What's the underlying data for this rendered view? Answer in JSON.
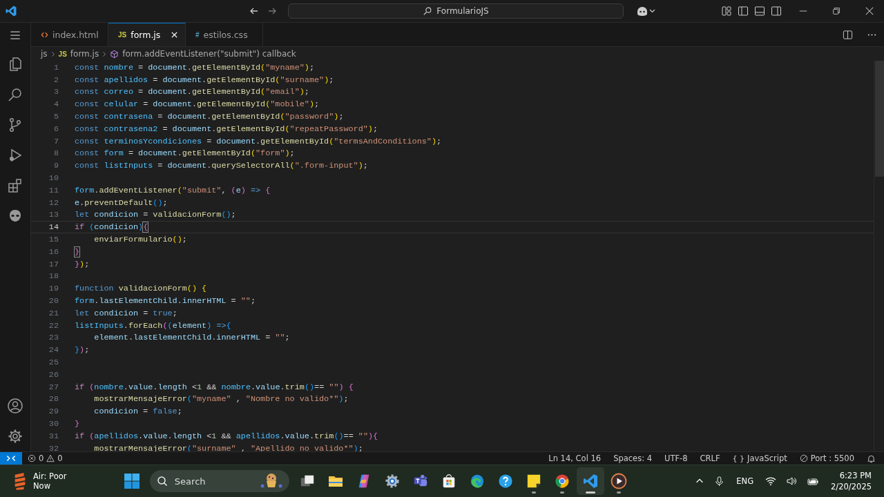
{
  "window": {
    "title": "FormularioJS"
  },
  "tabs": [
    {
      "label": "index.html",
      "kind": "html",
      "selected": false
    },
    {
      "label": "form.js",
      "kind": "js",
      "icon_text": "JS",
      "selected": true
    },
    {
      "label": "estilos.css",
      "kind": "css",
      "icon_text": "#",
      "selected": false
    }
  ],
  "breadcrumb": [
    {
      "kind": "folder",
      "label": "js"
    },
    {
      "kind": "file",
      "label": "form.js",
      "icon_text": "JS"
    },
    {
      "kind": "symbol",
      "label": "form.addEventListener(\"submit\") callback"
    }
  ],
  "editor": {
    "lines": [
      {
        "number": "1",
        "current": false,
        "tokens": [
          {
            "kind": "keyword",
            "text": "const "
          },
          {
            "kind": "constant",
            "text": "nombre"
          },
          {
            "kind": "plain",
            "text": " = "
          },
          {
            "kind": "variable",
            "text": "document"
          },
          {
            "kind": "plain",
            "text": "."
          },
          {
            "kind": "function",
            "text": "getElementById"
          },
          {
            "kind": "bracket1",
            "text": "("
          },
          {
            "kind": "string",
            "text": "\"myname\""
          },
          {
            "kind": "bracket1",
            "text": ")"
          },
          {
            "kind": "plain",
            "text": ";"
          }
        ]
      },
      {
        "number": "2",
        "current": false,
        "tokens": [
          {
            "kind": "keyword",
            "text": "const "
          },
          {
            "kind": "constant",
            "text": "apellidos"
          },
          {
            "kind": "plain",
            "text": " = "
          },
          {
            "kind": "variable",
            "text": "document"
          },
          {
            "kind": "plain",
            "text": "."
          },
          {
            "kind": "function",
            "text": "getElementById"
          },
          {
            "kind": "bracket1",
            "text": "("
          },
          {
            "kind": "string",
            "text": "\"surname\""
          },
          {
            "kind": "bracket1",
            "text": ")"
          },
          {
            "kind": "plain",
            "text": ";"
          }
        ]
      },
      {
        "number": "3",
        "current": false,
        "tokens": [
          {
            "kind": "keyword",
            "text": "const "
          },
          {
            "kind": "constant",
            "text": "correo"
          },
          {
            "kind": "plain",
            "text": " = "
          },
          {
            "kind": "variable",
            "text": "document"
          },
          {
            "kind": "plain",
            "text": "."
          },
          {
            "kind": "function",
            "text": "getElementById"
          },
          {
            "kind": "bracket1",
            "text": "("
          },
          {
            "kind": "string",
            "text": "\"email\""
          },
          {
            "kind": "bracket1",
            "text": ")"
          },
          {
            "kind": "plain",
            "text": ";"
          }
        ]
      },
      {
        "number": "4",
        "current": false,
        "tokens": [
          {
            "kind": "keyword",
            "text": "const "
          },
          {
            "kind": "constant",
            "text": "celular"
          },
          {
            "kind": "plain",
            "text": " = "
          },
          {
            "kind": "variable",
            "text": "document"
          },
          {
            "kind": "plain",
            "text": "."
          },
          {
            "kind": "function",
            "text": "getElementById"
          },
          {
            "kind": "bracket1",
            "text": "("
          },
          {
            "kind": "string",
            "text": "\"mobile\""
          },
          {
            "kind": "bracket1",
            "text": ")"
          },
          {
            "kind": "plain",
            "text": ";"
          }
        ]
      },
      {
        "number": "5",
        "current": false,
        "tokens": [
          {
            "kind": "keyword",
            "text": "const "
          },
          {
            "kind": "constant",
            "text": "contrasena"
          },
          {
            "kind": "plain",
            "text": " = "
          },
          {
            "kind": "variable",
            "text": "document"
          },
          {
            "kind": "plain",
            "text": "."
          },
          {
            "kind": "function",
            "text": "getElementById"
          },
          {
            "kind": "bracket1",
            "text": "("
          },
          {
            "kind": "string",
            "text": "\"password\""
          },
          {
            "kind": "bracket1",
            "text": ")"
          },
          {
            "kind": "plain",
            "text": ";"
          }
        ]
      },
      {
        "number": "6",
        "current": false,
        "tokens": [
          {
            "kind": "keyword",
            "text": "const "
          },
          {
            "kind": "constant",
            "text": "contrasena2"
          },
          {
            "kind": "plain",
            "text": " = "
          },
          {
            "kind": "variable",
            "text": "document"
          },
          {
            "kind": "plain",
            "text": "."
          },
          {
            "kind": "function",
            "text": "getElementById"
          },
          {
            "kind": "bracket1",
            "text": "("
          },
          {
            "kind": "string",
            "text": "\"repeatPassword\""
          },
          {
            "kind": "bracket1",
            "text": ")"
          },
          {
            "kind": "plain",
            "text": ";"
          }
        ]
      },
      {
        "number": "7",
        "current": false,
        "tokens": [
          {
            "kind": "keyword",
            "text": "const "
          },
          {
            "kind": "constant",
            "text": "terminosYcondiciones"
          },
          {
            "kind": "plain",
            "text": " = "
          },
          {
            "kind": "variable",
            "text": "document"
          },
          {
            "kind": "plain",
            "text": "."
          },
          {
            "kind": "function",
            "text": "getElementById"
          },
          {
            "kind": "bracket1",
            "text": "("
          },
          {
            "kind": "string",
            "text": "\"termsAndConditions\""
          },
          {
            "kind": "bracket1",
            "text": ")"
          },
          {
            "kind": "plain",
            "text": ";"
          }
        ]
      },
      {
        "number": "8",
        "current": false,
        "tokens": [
          {
            "kind": "keyword",
            "text": "const "
          },
          {
            "kind": "constant",
            "text": "form"
          },
          {
            "kind": "plain",
            "text": " = "
          },
          {
            "kind": "variable",
            "text": "document"
          },
          {
            "kind": "plain",
            "text": "."
          },
          {
            "kind": "function",
            "text": "getElementById"
          },
          {
            "kind": "bracket1",
            "text": "("
          },
          {
            "kind": "string",
            "text": "\"form\""
          },
          {
            "kind": "bracket1",
            "text": ")"
          },
          {
            "kind": "plain",
            "text": ";"
          }
        ]
      },
      {
        "number": "9",
        "current": false,
        "tokens": [
          {
            "kind": "keyword",
            "text": "const "
          },
          {
            "kind": "constant",
            "text": "listInputs"
          },
          {
            "kind": "plain",
            "text": " = "
          },
          {
            "kind": "variable",
            "text": "document"
          },
          {
            "kind": "plain",
            "text": "."
          },
          {
            "kind": "function",
            "text": "querySelectorAll"
          },
          {
            "kind": "bracket1",
            "text": "("
          },
          {
            "kind": "string",
            "text": "\".form-input\""
          },
          {
            "kind": "bracket1",
            "text": ")"
          },
          {
            "kind": "plain",
            "text": ";"
          }
        ]
      },
      {
        "number": "10",
        "current": false
      },
      {
        "number": "11",
        "current": false,
        "tokens": [
          {
            "kind": "constant",
            "text": "form"
          },
          {
            "kind": "plain",
            "text": "."
          },
          {
            "kind": "function",
            "text": "addEventListener"
          },
          {
            "kind": "bracket1",
            "text": "("
          },
          {
            "kind": "string",
            "text": "\"submit\""
          },
          {
            "kind": "plain",
            "text": ", "
          },
          {
            "kind": "bracket2",
            "text": "("
          },
          {
            "kind": "variable",
            "text": "e"
          },
          {
            "kind": "bracket2",
            "text": ")"
          },
          {
            "kind": "keyword",
            "text": " => "
          },
          {
            "kind": "bracket2",
            "text": "{"
          }
        ]
      },
      {
        "number": "12",
        "current": false,
        "tokens": [
          {
            "kind": "variable",
            "text": "e"
          },
          {
            "kind": "plain",
            "text": "."
          },
          {
            "kind": "function",
            "text": "preventDefault"
          },
          {
            "kind": "bracket3",
            "text": "()"
          },
          {
            "kind": "plain",
            "text": ";"
          }
        ]
      },
      {
        "number": "13",
        "current": false,
        "tokens": [
          {
            "kind": "keyword",
            "text": "let "
          },
          {
            "kind": "variable",
            "text": "condicion"
          },
          {
            "kind": "plain",
            "text": " = "
          },
          {
            "kind": "function",
            "text": "validacionForm"
          },
          {
            "kind": "bracket3",
            "text": "()"
          },
          {
            "kind": "plain",
            "text": ";"
          }
        ]
      },
      {
        "number": "14",
        "current": true,
        "tokens": [
          {
            "kind": "control",
            "text": "if "
          },
          {
            "kind": "bracket3",
            "text": "("
          },
          {
            "kind": "variable",
            "text": "condicion"
          },
          {
            "kind": "bracket3",
            "text": ")"
          },
          {
            "kind": "match",
            "text": "{"
          }
        ]
      },
      {
        "number": "15",
        "current": false,
        "tokens": [
          {
            "kind": "function",
            "text": "    enviarFormulario"
          },
          {
            "kind": "bracket1",
            "text": "()"
          },
          {
            "kind": "plain",
            "text": ";"
          }
        ]
      },
      {
        "number": "16",
        "current": false,
        "tokens": [
          {
            "kind": "match",
            "text": "}"
          }
        ]
      },
      {
        "number": "17",
        "current": false,
        "tokens": [
          {
            "kind": "bracket2",
            "text": "}"
          },
          {
            "kind": "bracket1",
            "text": ")"
          },
          {
            "kind": "plain",
            "text": ";"
          }
        ]
      },
      {
        "number": "18",
        "current": false
      },
      {
        "number": "19",
        "current": false,
        "tokens": [
          {
            "kind": "keyword",
            "text": "function "
          },
          {
            "kind": "function",
            "text": "validacionForm"
          },
          {
            "kind": "bracket1",
            "text": "()"
          },
          {
            "kind": "bracket1",
            "text": " {"
          }
        ]
      },
      {
        "number": "20",
        "current": false,
        "tokens": [
          {
            "kind": "constant",
            "text": "form"
          },
          {
            "kind": "plain",
            "text": "."
          },
          {
            "kind": "variable",
            "text": "lastElementChild"
          },
          {
            "kind": "plain",
            "text": "."
          },
          {
            "kind": "variable",
            "text": "innerHTML"
          },
          {
            "kind": "plain",
            "text": " = "
          },
          {
            "kind": "string",
            "text": "\"\""
          },
          {
            "kind": "plain",
            "text": ";"
          }
        ]
      },
      {
        "number": "21",
        "current": false,
        "tokens": [
          {
            "kind": "keyword",
            "text": "let "
          },
          {
            "kind": "variable",
            "text": "condicion"
          },
          {
            "kind": "plain",
            "text": " = "
          },
          {
            "kind": "keyword",
            "text": "true"
          },
          {
            "kind": "plain",
            "text": ";"
          }
        ]
      },
      {
        "number": "22",
        "current": false,
        "tokens": [
          {
            "kind": "constant",
            "text": "listInputs"
          },
          {
            "kind": "plain",
            "text": "."
          },
          {
            "kind": "function",
            "text": "forEach"
          },
          {
            "kind": "bracket2",
            "text": "("
          },
          {
            "kind": "bracket3",
            "text": "("
          },
          {
            "kind": "variable",
            "text": "element"
          },
          {
            "kind": "bracket3",
            "text": ")"
          },
          {
            "kind": "keyword",
            "text": " =>"
          },
          {
            "kind": "bracket3",
            "text": "{"
          }
        ]
      },
      {
        "number": "23",
        "current": false,
        "tokens": [
          {
            "kind": "variable",
            "text": "    element"
          },
          {
            "kind": "plain",
            "text": "."
          },
          {
            "kind": "variable",
            "text": "lastElementChild"
          },
          {
            "kind": "plain",
            "text": "."
          },
          {
            "kind": "variable",
            "text": "innerHTML"
          },
          {
            "kind": "plain",
            "text": " = "
          },
          {
            "kind": "string",
            "text": "\"\""
          },
          {
            "kind": "plain",
            "text": ";"
          }
        ]
      },
      {
        "number": "24",
        "current": false,
        "tokens": [
          {
            "kind": "bracket3",
            "text": "}"
          },
          {
            "kind": "bracket2",
            "text": ")"
          },
          {
            "kind": "plain",
            "text": ";"
          }
        ]
      },
      {
        "number": "25",
        "current": false
      },
      {
        "number": "26",
        "current": false
      },
      {
        "number": "27",
        "current": false,
        "tokens": [
          {
            "kind": "control",
            "text": "if "
          },
          {
            "kind": "bracket2",
            "text": "("
          },
          {
            "kind": "constant",
            "text": "nombre"
          },
          {
            "kind": "plain",
            "text": "."
          },
          {
            "kind": "variable",
            "text": "value"
          },
          {
            "kind": "plain",
            "text": "."
          },
          {
            "kind": "variable",
            "text": "length"
          },
          {
            "kind": "plain",
            "text": " <"
          },
          {
            "kind": "number",
            "text": "1"
          },
          {
            "kind": "plain",
            "text": " && "
          },
          {
            "kind": "constant",
            "text": "nombre"
          },
          {
            "kind": "plain",
            "text": "."
          },
          {
            "kind": "variable",
            "text": "value"
          },
          {
            "kind": "plain",
            "text": "."
          },
          {
            "kind": "function",
            "text": "trim"
          },
          {
            "kind": "bracket3",
            "text": "()"
          },
          {
            "kind": "plain",
            "text": "== "
          },
          {
            "kind": "string",
            "text": "\"\""
          },
          {
            "kind": "bracket2",
            "text": ") {"
          }
        ]
      },
      {
        "number": "28",
        "current": false,
        "tokens": [
          {
            "kind": "function",
            "text": "    mostrarMensajeError"
          },
          {
            "kind": "bracket3",
            "text": "("
          },
          {
            "kind": "string",
            "text": "\"myname\""
          },
          {
            "kind": "plain",
            "text": " , "
          },
          {
            "kind": "string",
            "text": "\"Nombre no valido*\""
          },
          {
            "kind": "bracket3",
            "text": ")"
          },
          {
            "kind": "plain",
            "text": ";"
          }
        ]
      },
      {
        "number": "29",
        "current": false,
        "tokens": [
          {
            "kind": "variable",
            "text": "    condicion"
          },
          {
            "kind": "plain",
            "text": " = "
          },
          {
            "kind": "keyword",
            "text": "false"
          },
          {
            "kind": "plain",
            "text": ";"
          }
        ]
      },
      {
        "number": "30",
        "current": false,
        "tokens": [
          {
            "kind": "bracket2",
            "text": "}"
          }
        ]
      },
      {
        "number": "31",
        "current": false,
        "tokens": [
          {
            "kind": "control",
            "text": "if "
          },
          {
            "kind": "bracket2",
            "text": "("
          },
          {
            "kind": "constant",
            "text": "apellidos"
          },
          {
            "kind": "plain",
            "text": "."
          },
          {
            "kind": "variable",
            "text": "value"
          },
          {
            "kind": "plain",
            "text": "."
          },
          {
            "kind": "variable",
            "text": "length"
          },
          {
            "kind": "plain",
            "text": " <"
          },
          {
            "kind": "number",
            "text": "1"
          },
          {
            "kind": "plain",
            "text": " && "
          },
          {
            "kind": "constant",
            "text": "apellidos"
          },
          {
            "kind": "plain",
            "text": "."
          },
          {
            "kind": "variable",
            "text": "value"
          },
          {
            "kind": "plain",
            "text": "."
          },
          {
            "kind": "function",
            "text": "trim"
          },
          {
            "kind": "bracket3",
            "text": "()"
          },
          {
            "kind": "plain",
            "text": "== "
          },
          {
            "kind": "string",
            "text": "\"\""
          },
          {
            "kind": "bracket2",
            "text": "){"
          }
        ]
      },
      {
        "number": "32",
        "current": false,
        "tokens": [
          {
            "kind": "function",
            "text": "    mostrarMensajeError"
          },
          {
            "kind": "bracket3",
            "text": "("
          },
          {
            "kind": "string",
            "text": "\"surname\""
          },
          {
            "kind": "plain",
            "text": " , "
          },
          {
            "kind": "string",
            "text": "\"Apellido no valido*\""
          },
          {
            "kind": "bracket3",
            "text": ")"
          },
          {
            "kind": "plain",
            "text": ";"
          }
        ]
      }
    ]
  },
  "status_bar": {
    "errors": "0",
    "warnings": "0",
    "items": [
      {
        "kind": "text",
        "label": "Ln 14, Col 16"
      },
      {
        "kind": "text",
        "label": "Spaces: 4"
      },
      {
        "kind": "text",
        "label": "UTF-8"
      },
      {
        "kind": "text",
        "label": "CRLF"
      },
      {
        "kind": "language",
        "icon_text": "{ }",
        "label": "JavaScript"
      },
      {
        "kind": "port",
        "label": "Port : 5500"
      }
    ]
  },
  "taskbar": {
    "weather": {
      "title": "Air: Poor",
      "subtitle": "Now"
    },
    "search": {
      "placeholder": "Search"
    },
    "apps": [
      {
        "kind": "task-view",
        "running": false,
        "active": false
      },
      {
        "kind": "explorer",
        "running": false,
        "active": false
      },
      {
        "kind": "copilot",
        "running": false,
        "active": false
      },
      {
        "kind": "settings",
        "running": false,
        "active": false
      },
      {
        "kind": "teams",
        "running": false,
        "active": false
      },
      {
        "kind": "store",
        "running": false,
        "active": false
      },
      {
        "kind": "edge",
        "running": false,
        "active": false
      },
      {
        "kind": "help",
        "running": false,
        "active": false
      },
      {
        "kind": "notes",
        "running": true,
        "active": false
      },
      {
        "kind": "chrome",
        "running": true,
        "active": false
      },
      {
        "kind": "vscode",
        "running": true,
        "active": true
      },
      {
        "kind": "player",
        "running": true,
        "active": false
      }
    ],
    "language": "ENG",
    "time": "6:23 PM",
    "date": "2/20/2025"
  }
}
